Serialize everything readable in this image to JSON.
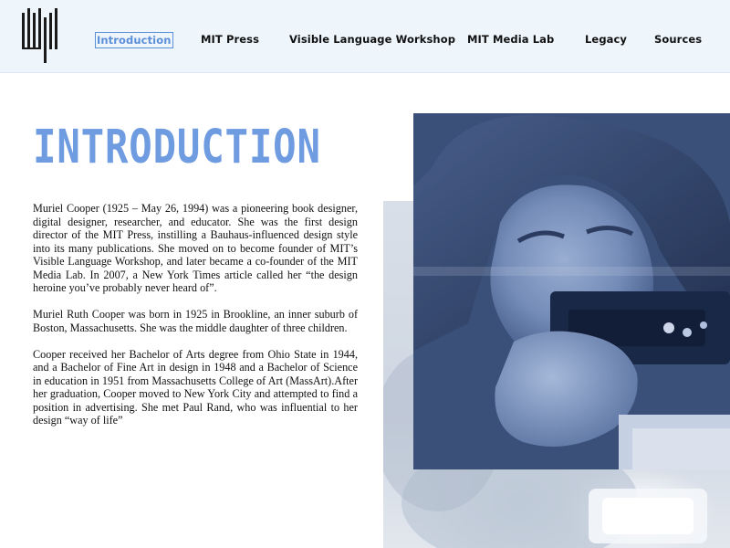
{
  "nav": {
    "logo": "logo-mark",
    "items": [
      {
        "label": "Introduction",
        "active": true
      },
      {
        "label": "MIT Press"
      },
      {
        "label": "Visible Language Workshop"
      },
      {
        "label": "MIT Media Lab"
      },
      {
        "label": "Legacy"
      },
      {
        "label": "Sources"
      }
    ]
  },
  "main": {
    "title": "INTRODUCTION",
    "paragraphs": [
      "Muriel Cooper (1925 – May 26, 1994) was a pioneering book designer, digital designer, researcher, and educator. She was the first design director of the MIT Press, instilling a Bauhaus-influenced design style into its many publications. She moved on to become founder of MIT’s Visible Language Workshop, and later became a co-founder of the MIT Media Lab. In 2007, a New York Times article called her “the design heroine you’ve probably never heard of”.",
      "Muriel Ruth Cooper was born in 1925 in Brookline, an inner suburb of Boston, Massachusetts. She was the middle daughter of three children.",
      "Cooper received her Bachelor of Arts degree from Ohio State in 1944, and a Bachelor of Fine Art in design in 1948 and a Bachelor of Science in education in 1951 from Massachusetts College of Art (MassArt).After her graduation, Cooper moved to New York City and attempted to find a position in advertising. She met Paul Rand, who was influential to her design “way of life”"
    ]
  },
  "colors": {
    "accent": "#6f9be0",
    "header_bg": "#eef5fb",
    "photo_tint": "#2f4468"
  }
}
